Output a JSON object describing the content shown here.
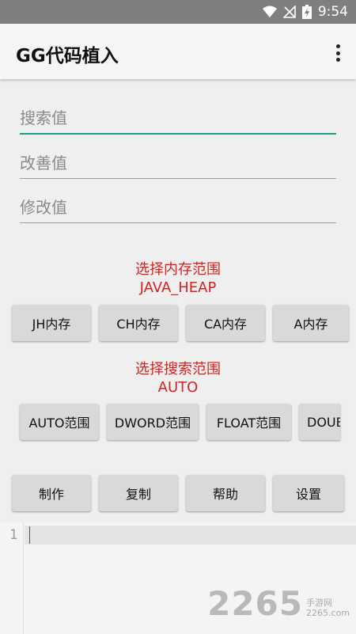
{
  "status_bar": {
    "time": "9:54"
  },
  "app": {
    "title": "GG代码植入"
  },
  "fields": {
    "search_placeholder": "搜索值",
    "improve_placeholder": "改善值",
    "modify_placeholder": "修改值"
  },
  "memory": {
    "heading": "选择内存范围",
    "selected": "JAVA_HEAP",
    "buttons": [
      "JH内存",
      "CH内存",
      "CA内存",
      "A内存"
    ]
  },
  "search_range": {
    "heading": "选择搜索范围",
    "selected": "AUTO",
    "buttons": [
      "AUTO范围",
      "DWORD范围",
      "FLOAT范围",
      "DOUB"
    ]
  },
  "actions": {
    "buttons": [
      "制作",
      "复制",
      "帮助",
      "设置"
    ]
  },
  "editor": {
    "line_number": "1"
  },
  "watermark": {
    "brand": "2265",
    "site": "手游网",
    "domain": "2265.com"
  },
  "colors": {
    "accent": "#1e9e8c",
    "label_red": "#d8211f",
    "button_bg": "#d9d9d9"
  }
}
